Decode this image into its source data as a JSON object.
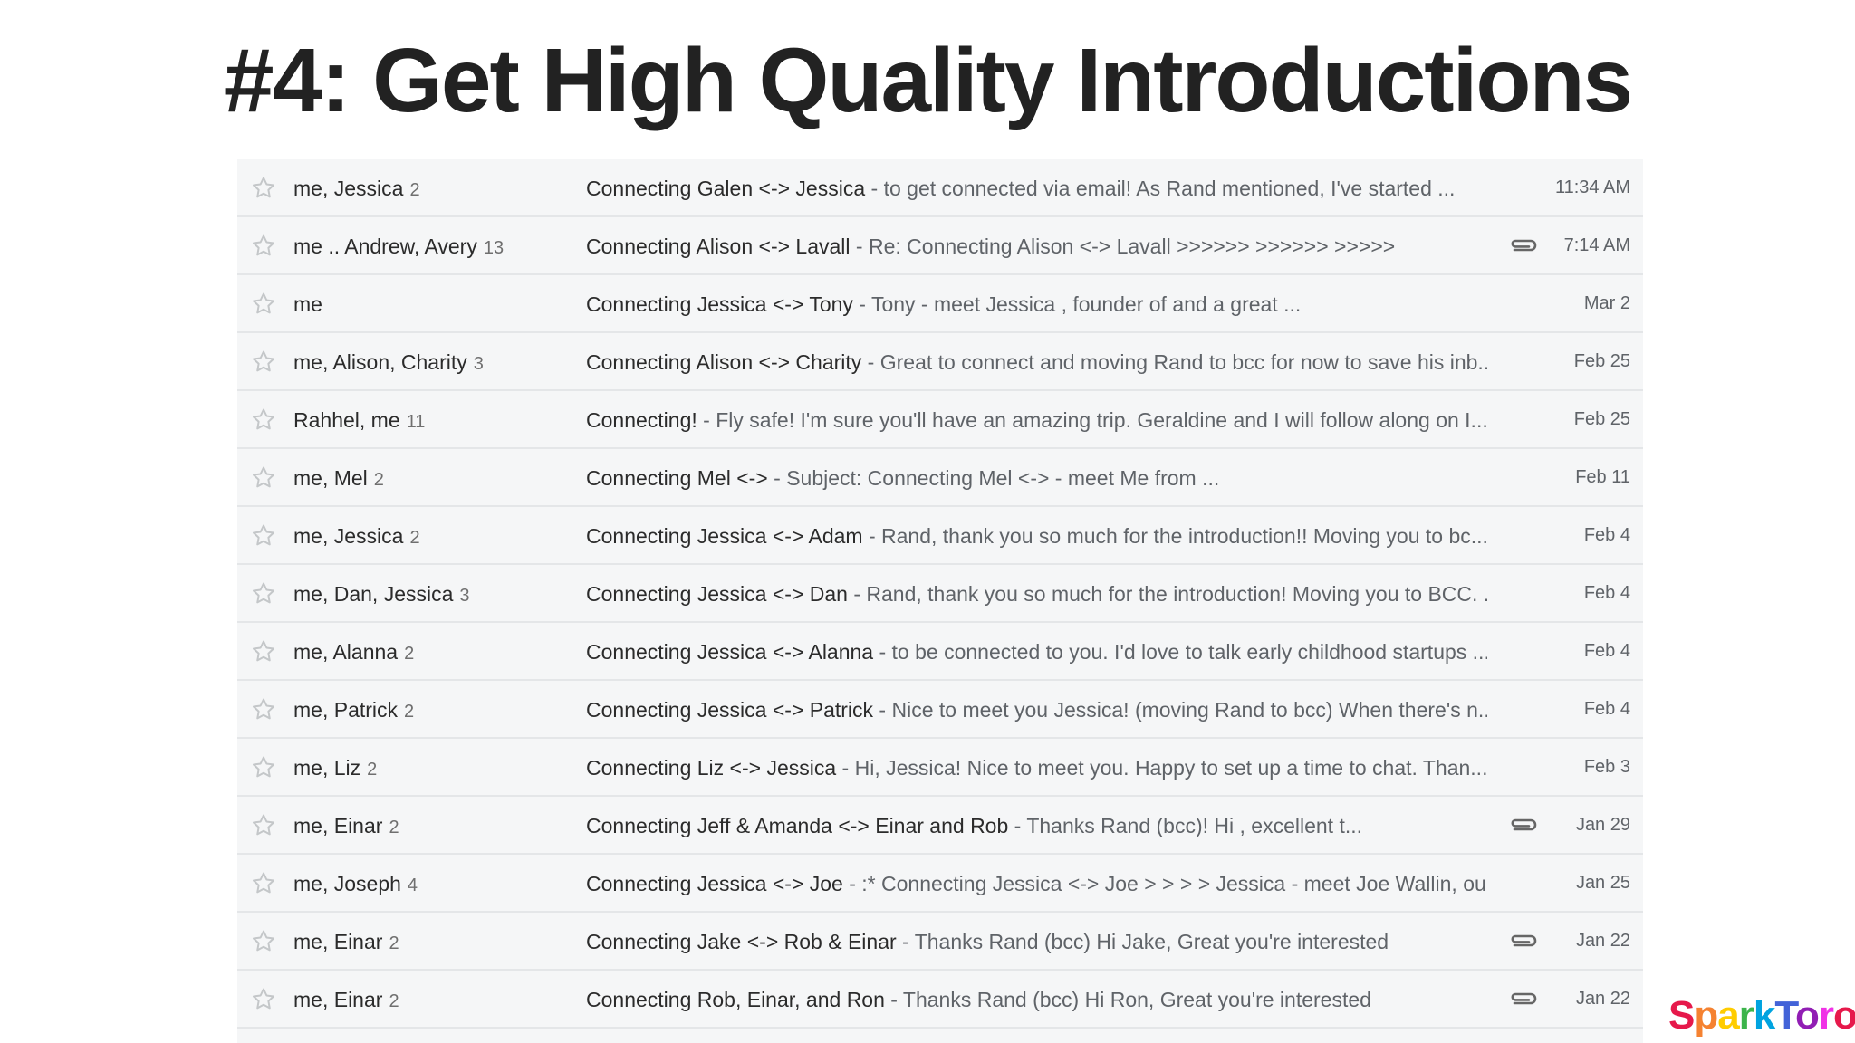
{
  "title": "#4: Get High Quality Introductions",
  "logo": {
    "text": "SparkToro",
    "colors": [
      "#e6194b",
      "#f58231",
      "#ffcc00",
      "#3cb44b",
      "#00a3e0",
      "#4363d8",
      "#911eb4",
      "#f032e6",
      "#e6194b"
    ]
  },
  "icons": {
    "star": "star-outline-icon",
    "attachment": "paperclip-icon"
  },
  "rows": [
    {
      "sender": "me, Jessica",
      "count": "2",
      "subject": "Connecting Galen <-> Jessica",
      "snippet": "to get connected via email! As Rand mentioned, I've started ...",
      "date": "11:34 AM",
      "attachment": false
    },
    {
      "sender": "me .. Andrew, Avery",
      "count": "13",
      "subject": "Connecting Alison <-> Lavall",
      "snippet": "Re: Connecting Alison <-> Lavall >>>>>> >>>>>> >>>>>",
      "date": "7:14 AM",
      "attachment": true
    },
    {
      "sender": "me",
      "count": "",
      "subject": "Connecting Jessica <-> Tony",
      "snippet": "Tony - meet Jessica , founder of and a great ...",
      "date": "Mar 2",
      "attachment": false
    },
    {
      "sender": "me, Alison, Charity",
      "count": "3",
      "subject": "Connecting Alison <-> Charity",
      "snippet": "Great to connect and moving Rand to bcc for now to save his inb...",
      "date": "Feb 25",
      "attachment": false
    },
    {
      "sender": "Rahhel, me",
      "count": "11",
      "subject": "Connecting!",
      "snippet": "Fly safe! I'm sure you'll have an amazing trip. Geraldine and I will follow along on I...",
      "date": "Feb 25",
      "attachment": false
    },
    {
      "sender": "me, Mel",
      "count": "2",
      "subject": "Connecting Mel <->",
      "snippet": "Subject: Connecting Mel <-> - meet Me from ...",
      "date": "Feb 11",
      "attachment": false
    },
    {
      "sender": "me, Jessica",
      "count": "2",
      "subject": "Connecting Jessica <-> Adam",
      "snippet": "Rand, thank you so much for the introduction!! Moving you to bc...",
      "date": "Feb 4",
      "attachment": false
    },
    {
      "sender": "me, Dan, Jessica",
      "count": "3",
      "subject": "Connecting Jessica <-> Dan",
      "snippet": "Rand, thank you so much for the introduction! Moving you to BCC. ...",
      "date": "Feb 4",
      "attachment": false
    },
    {
      "sender": "me, Alanna",
      "count": "2",
      "subject": "Connecting Jessica <-> Alanna",
      "snippet": "to be connected to you. I'd love to talk early childhood startups ...",
      "date": "Feb 4",
      "attachment": false
    },
    {
      "sender": "me, Patrick",
      "count": "2",
      "subject": "Connecting Jessica <-> Patrick",
      "snippet": "Nice to meet you Jessica! (moving Rand to bcc) When there's n...",
      "date": "Feb 4",
      "attachment": false
    },
    {
      "sender": "me, Liz",
      "count": "2",
      "subject": "Connecting Liz <-> Jessica",
      "snippet": "Hi, Jessica! Nice to meet you. Happy to set up a time to chat. Than...",
      "date": "Feb 3",
      "attachment": false
    },
    {
      "sender": "me, Einar",
      "count": "2",
      "subject": "Connecting Jeff & Amanda <-> Einar and Rob",
      "snippet": "Thanks Rand (bcc)! Hi , excellent t...",
      "date": "Jan 29",
      "attachment": true
    },
    {
      "sender": "me, Joseph",
      "count": "4",
      "subject": "Connecting Jessica <-> Joe",
      "snippet": ":* Connecting Jessica <-> Joe > > > > Jessica - meet Joe Wallin, ou...",
      "date": "Jan 25",
      "attachment": false
    },
    {
      "sender": "me, Einar",
      "count": "2",
      "subject": "Connecting Jake <-> Rob & Einar",
      "snippet": "Thanks Rand (bcc) Hi Jake, Great you're interested",
      "date": "Jan 22",
      "attachment": true
    },
    {
      "sender": "me, Einar",
      "count": "2",
      "subject": "Connecting Rob, Einar, and Ron",
      "snippet": "Thanks Rand (bcc) Hi Ron, Great you're interested",
      "date": "Jan 22",
      "attachment": true
    }
  ]
}
